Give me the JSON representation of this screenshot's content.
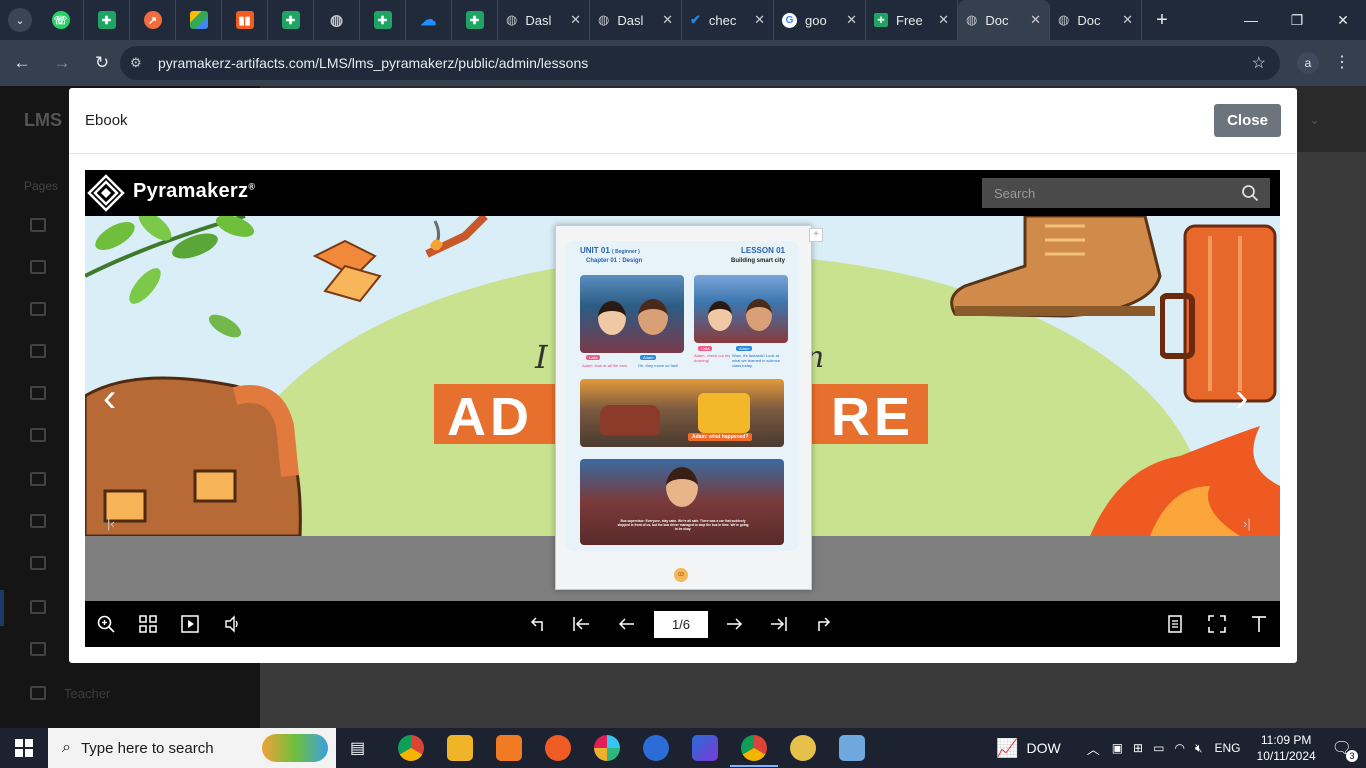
{
  "browser": {
    "tabs": [
      {
        "title": "Dasl",
        "icon": "globe-icon"
      },
      {
        "title": "Dasl",
        "icon": "globe-icon"
      },
      {
        "title": "chec",
        "icon": "check-icon"
      },
      {
        "title": "goo",
        "icon": "google-icon"
      },
      {
        "title": "Free",
        "icon": "sheets-icon"
      },
      {
        "title": "Doc",
        "icon": "globe-icon",
        "active": true
      },
      {
        "title": "Doc",
        "icon": "globe-icon"
      }
    ],
    "url": "pyramakerz-artifacts.com/LMS/lms_pyramakerz/public/admin/lessons",
    "profile_initial": "a"
  },
  "background_page": {
    "brand": "LMS",
    "sidebar_heading": "Pages",
    "sidebar_last_item": "Teacher"
  },
  "modal": {
    "title": "Ebook",
    "close_label": "Close",
    "viewer": {
      "brand": "Pyramakerz",
      "brand_mark": "®",
      "search_placeholder": "Search",
      "page_indicator": "1/6",
      "book_page": {
        "unit": "UNIT 01",
        "unit_level": "( Beginner )",
        "lesson": "LESSON 01",
        "chapter": "Chapter 01 : Design",
        "topic": "Building smart city",
        "panel1_names": [
          "Laila",
          "Adam"
        ],
        "panel1_caption_a": "Adam, look at all the cars.",
        "panel1_caption_b": "Oh, they move so fast!",
        "panel2_names": [
          "Laila",
          "Adam"
        ],
        "panel2_caption_a": "Adam, check out my drawing!",
        "panel2_caption_b": "Wow, it's fantastic! Look at what we learned in science class today.",
        "panel3_caption": "Adam: what happened?",
        "panel4_caption": "Bus supervisor: Everyone, stay calm. We're all safe. There was a car that suddenly stopped in front of us, but the bus driver managed to stop the bus in time. We're going to be okay.",
        "page_number": "03"
      },
      "cover_words": {
        "script": "I",
        "script_right": "n",
        "big_left": "AD",
        "big_right": "RE"
      }
    }
  },
  "taskbar": {
    "search_placeholder": "Type here to search",
    "stock": "DOW",
    "language": "ENG",
    "time": "11:09 PM",
    "date": "10/11/2024",
    "notifications": "3"
  }
}
